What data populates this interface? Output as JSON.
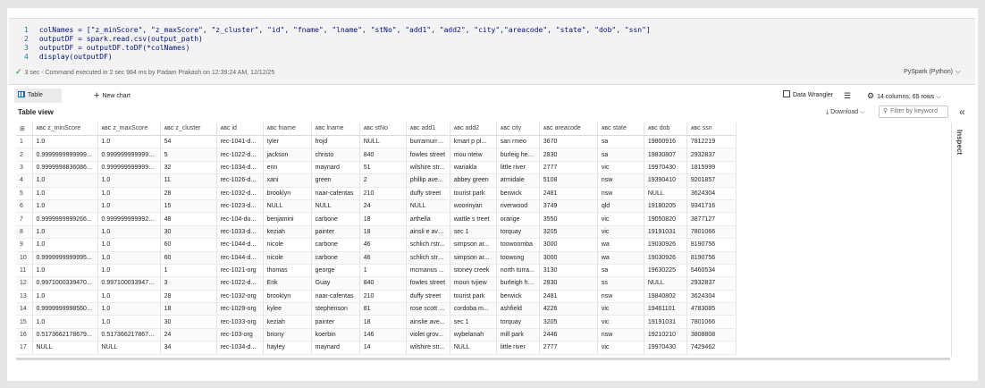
{
  "code": {
    "lines": [
      {
        "num": "1",
        "text": "colNames = [\"z_minScore\", \"z_maxScore\", \"z_cluster\", \"id\", \"fname\", \"lname\", \"stNo\", \"add1\", \"add2\", \"city\",\"areacode\", \"state\", \"dob\", \"ssn\"]"
      },
      {
        "num": "2",
        "text": "outputDF = spark.read.csv(output_path)"
      },
      {
        "num": "3",
        "text": "outputDF = outputDF.toDF(*colNames)"
      },
      {
        "num": "4",
        "text": "display(outputDF)"
      }
    ],
    "status": "3 sec - Command executed in 2 sec 984 ms by Padam Prakash on 12:39:24 AM, 12/12/25",
    "language": "PySpark (Python)"
  },
  "toolbar": {
    "table_tab": "Table",
    "new_chart": "New chart",
    "data_wrangler": "Data Wrangler",
    "columns_info": "14 columns, 65 rows"
  },
  "view": {
    "title": "Table view",
    "download": "Download",
    "filter_placeholder": "Filter by keyword",
    "inspect": "Inspect"
  },
  "table": {
    "columns": [
      "z_minScore",
      "z_maxScore",
      "z_cluster",
      "id",
      "fname",
      "lname",
      "stNo",
      "add1",
      "add2",
      "city",
      "areacode",
      "state",
      "dob",
      "ssn"
    ],
    "rows": [
      [
        "1",
        "1.0",
        "1.0",
        "54",
        "rec-1041-d...",
        "tyler",
        "frojd",
        "NULL",
        "burramurra...",
        "kmart p pl...",
        "san rmeo",
        "3670",
        "sa",
        "19800916",
        "7812219"
      ],
      [
        "2",
        "0.9999999999999...",
        "0.9999999999999...",
        "5",
        "rec-1022-d...",
        "jackson",
        "christo",
        "840",
        "fowles street",
        "mou nteiw",
        "burleig hea...",
        "2830",
        "sa",
        "19830807",
        "2932837"
      ],
      [
        "3",
        "0.9999998836086...",
        "0.999999999999948",
        "32",
        "rec-1034-d...",
        "erin",
        "maynard",
        "51",
        "wilshire str...",
        "wariakla",
        "little river",
        "2777",
        "vic",
        "19970430",
        "1815999"
      ],
      [
        "4",
        "1.0",
        "1.0",
        "11",
        "rec-1026-d...",
        "xani",
        "green",
        "2",
        "phillip ave...",
        "abbey green",
        "armidale",
        "5108",
        "nsw",
        "19390410",
        "9201857"
      ],
      [
        "5",
        "1.0",
        "1.0",
        "28",
        "rec-1032-d...",
        "brooklyn",
        "naar-cafentas",
        "210",
        "duffy street",
        "tourist park",
        "berwick",
        "2481",
        "nsw",
        "NULL",
        "3624304"
      ],
      [
        "6",
        "1.0",
        "1.0",
        "15",
        "rec-1023-d...",
        "NULL",
        "NULL",
        "24",
        "NULL",
        "woorinyan",
        "riverwood",
        "3749",
        "qld",
        "19180205",
        "9341716"
      ],
      [
        "7",
        "0.9999999999266...",
        "0.9999999999926...",
        "48",
        "rec-104-du...",
        "benjamini",
        "carbone",
        "18",
        "arthella",
        "wattle s treet",
        "orange",
        "3550",
        "vic",
        "19050820",
        "3877127"
      ],
      [
        "8",
        "1.0",
        "1.0",
        "30",
        "rec-1033-d...",
        "keziah",
        "painter",
        "18",
        "ainsli e ave...",
        "sec 1",
        "torquay",
        "3205",
        "vic",
        "19191031",
        "7801066"
      ],
      [
        "9",
        "1.0",
        "1.0",
        "60",
        "rec-1044-d...",
        "nicole",
        "carbone",
        "46",
        "schlich rstr...",
        "simpson ar...",
        "toowoomba",
        "3000",
        "wa",
        "19030926",
        "8190756"
      ],
      [
        "10",
        "0.9999999999995...",
        "1.0",
        "60",
        "rec-1044-d...",
        "nicole",
        "carbone",
        "46",
        "schlich street",
        "simpson ar...",
        "toowong",
        "3000",
        "wa",
        "19030926",
        "8190756"
      ],
      [
        "11",
        "1.0",
        "1.0",
        "1",
        "rec-1021-org",
        "thomas",
        "george",
        "1",
        "mcmanus ...",
        "stoney creek",
        "north turra...",
        "3130",
        "sa",
        "19630225",
        "5460534"
      ],
      [
        "12",
        "0.9971000339470...",
        "0.9971000339470...",
        "3",
        "rec-1022-d...",
        "Erik",
        "Guay",
        "840",
        "fowles street",
        "moun tvjiew",
        "burleigh he...",
        "2830",
        "ss",
        "NULL",
        "2932837"
      ],
      [
        "13",
        "1.0",
        "1.0",
        "28",
        "rec-1032-org",
        "brooklyn",
        "naar-cafentas",
        "210",
        "duffy street",
        "tourist park",
        "berwick",
        "2481",
        "nsw",
        "19840802",
        "3624304"
      ],
      [
        "14",
        "0.9999999998560...",
        "1.0",
        "18",
        "rec-1029-org",
        "kylee",
        "stephenson",
        "81",
        "rose scott c...",
        "cordoba m...",
        "ashfield",
        "4226",
        "vic",
        "19461101",
        "4783085"
      ],
      [
        "15",
        "1.0",
        "1.0",
        "30",
        "rec-1033-org",
        "keziah",
        "painter",
        "18",
        "ainslie ave...",
        "sec 1",
        "torquay",
        "3205",
        "vic",
        "19191031",
        "7801066"
      ],
      [
        "16",
        "0.5173662178679...",
        "0.5173662178679...",
        "24",
        "rec-103-org",
        "briony",
        "koerbin",
        "146",
        "violet grov...",
        "wybelanah",
        "mill park",
        "2446",
        "nsw",
        "19210210",
        "3808808"
      ],
      [
        "17",
        "NULL",
        "NULL",
        "34",
        "rec-1034-d...",
        "hayley",
        "maynard",
        "14",
        "wilshire str...",
        "NULL",
        "little river",
        "2777",
        "vic",
        "19970430",
        "7429462"
      ]
    ]
  }
}
